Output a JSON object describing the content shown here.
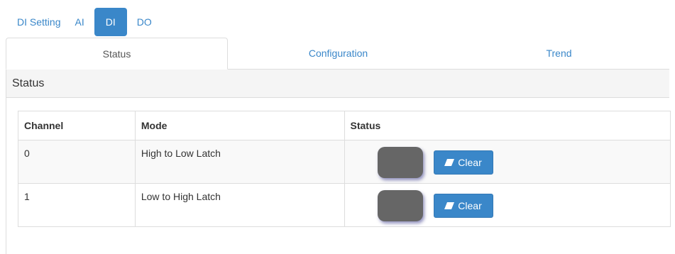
{
  "top_tabs": [
    {
      "label": "DI Setting",
      "active": false
    },
    {
      "label": "AI",
      "active": false
    },
    {
      "label": "DI",
      "active": true
    },
    {
      "label": "DO",
      "active": false
    }
  ],
  "sub_tabs": [
    {
      "label": "Status",
      "active": true
    },
    {
      "label": "Configuration",
      "active": false
    },
    {
      "label": "Trend",
      "active": false
    }
  ],
  "panel": {
    "title": "Status",
    "table": {
      "headers": [
        "Channel",
        "Mode",
        "Status"
      ],
      "rows": [
        {
          "channel": "0",
          "mode": "High to Low Latch",
          "led_icon": "led-indicator",
          "clear_label": "Clear"
        },
        {
          "channel": "1",
          "mode": "Low to High Latch",
          "led_icon": "led-indicator",
          "clear_label": "Clear"
        }
      ]
    }
  },
  "colors": {
    "accent": "#3a87c9",
    "led_off": "#666666"
  }
}
